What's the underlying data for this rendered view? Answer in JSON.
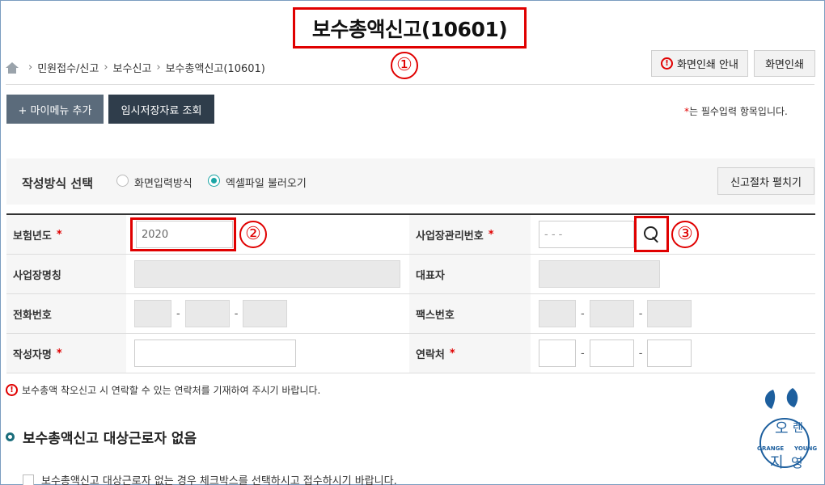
{
  "page": {
    "title": "보수총액신고(10601)",
    "markers": [
      "①",
      "②",
      "③"
    ]
  },
  "breadcrumb": [
    "민원접수/신고",
    "보수신고",
    "보수총액신고(10601)"
  ],
  "header_buttons": {
    "print_guide": "화면인쇄 안내",
    "print": "화면인쇄"
  },
  "toolbar": {
    "add_mymenu": "+ 마이메뉴 추가",
    "temp_lookup": "임시저장자료 조회",
    "required_note_star": "*",
    "required_note": "는 필수입력 항목입니다."
  },
  "method": {
    "label": "작성방식 선택",
    "options": [
      "화면입력방식",
      "엑셀파일 불러오기"
    ],
    "selected": "엑셀파일 불러오기",
    "procedure_button": "신고절차 펼치기"
  },
  "form": {
    "year_label": "보험년도",
    "year_value": "2020",
    "biz_no_label": "사업장관리번호",
    "biz_no_placeholder": "- -   -",
    "biz_name_label": "사업장명칭",
    "ceo_label": "대표자",
    "phone_label": "전화번호",
    "fax_label": "팩스번호",
    "writer_label": "작성자명",
    "contact_label": "연락처",
    "required_mark": "*",
    "separator": "-"
  },
  "notice": "보수총액 착오신고 시 연락할 수 있는 연락처를 기재하여 주시기 바랍니다.",
  "section": {
    "title": "보수총액신고 대상근로자 없음",
    "checkbox_label": "보수총액신고 대상근로자 없는 경우 체크박스를 선택하시고 접수하시기 바랍니다."
  },
  "logo_text": {
    "top": "오",
    "left_char": "지",
    "right_top": "렌",
    "right_bottom": "영",
    "orange": "ORANGE",
    "young": "YOUNG"
  },
  "colors": {
    "highlight_red": "#e00000",
    "dark_button": "#2f3d4b",
    "mymenu_button": "#5b6b7b",
    "radio_teal": "#1aa5a5",
    "logo_blue": "#1d5f9e"
  }
}
